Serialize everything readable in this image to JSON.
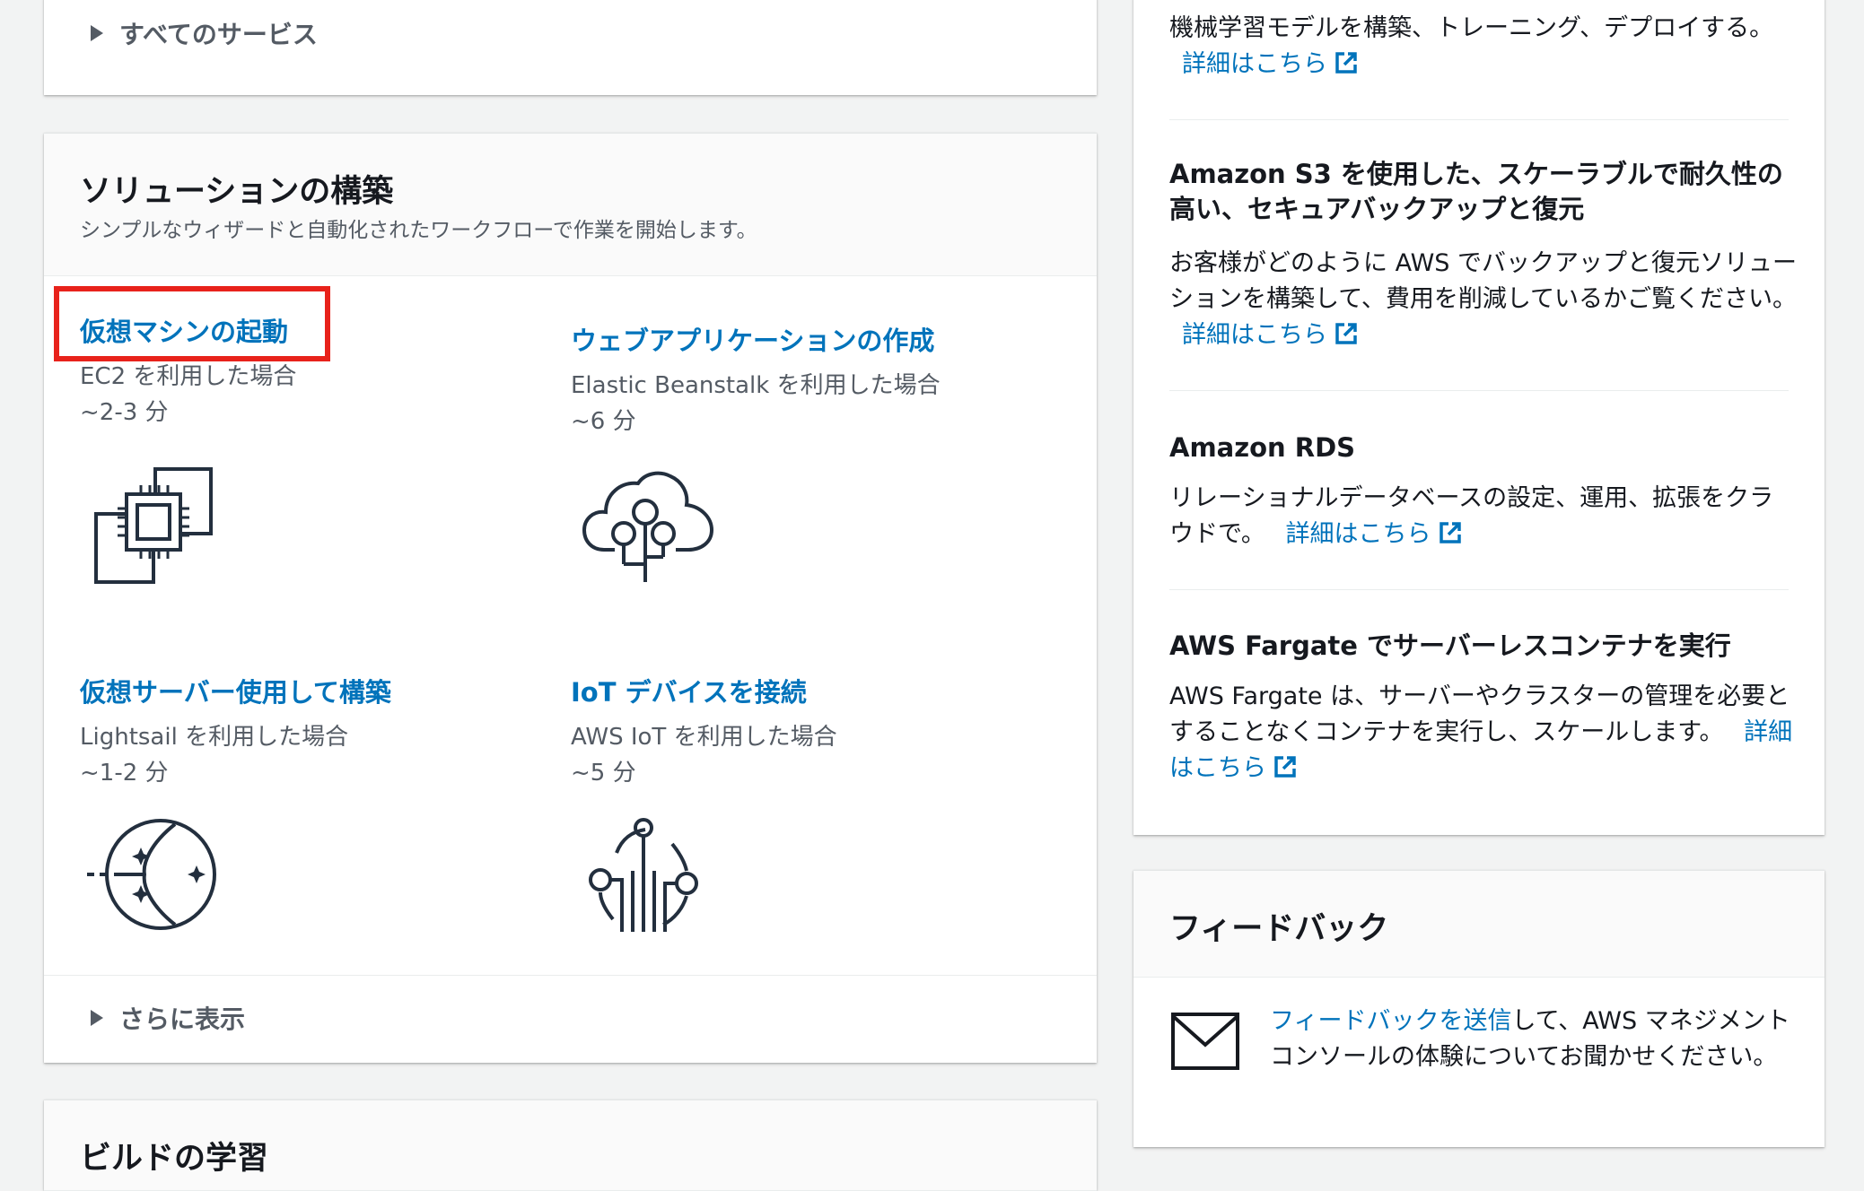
{
  "all_services": {
    "label": "すべてのサービス"
  },
  "solutions": {
    "title": "ソリューションの構築",
    "subtitle": "シンプルなウィザードと自動化されたワークフローで作業を開始します。",
    "items": [
      {
        "title": "仮想マシンの起動",
        "via": "EC2 を利用した場合",
        "time": "~2-3 分",
        "icon": "ec2-chip-icon"
      },
      {
        "title": "ウェブアプリケーションの作成",
        "via": "Elastic Beanstalk を利用した場合",
        "time": "~6 分",
        "icon": "beanstalk-cloud-icon"
      },
      {
        "title": "仮想サーバー使用して構築",
        "via": "Lightsail を利用した場合",
        "time": "~1-2 分",
        "icon": "lightsail-icon"
      },
      {
        "title": "IoT デバイスを接続",
        "via": "AWS IoT を利用した場合",
        "time": "~5 分",
        "icon": "iot-device-icon"
      }
    ],
    "show_more": "さらに表示"
  },
  "build_learning": {
    "title": "ビルドの学習"
  },
  "explore": {
    "link_text": "詳細はこちら",
    "items": [
      {
        "title": "",
        "body": "機械学習モデルを構築、トレーニング、デプロイする。"
      },
      {
        "title": "Amazon S3 を使用した、スケーラブルで耐久性の高い、セキュアバックアップと復元",
        "body": "お客様がどのように AWS でバックアップと復元ソリューションを構築して、費用を削減しているかご覧ください。"
      },
      {
        "title": "Amazon RDS",
        "body": "リレーショナルデータベースの設定、運用、拡張をクラウドで。"
      },
      {
        "title": "AWS Fargate でサーバーレスコンテナを実行",
        "body": "AWS Fargate は、サーバーやクラスターの管理を必要とすることなくコンテナを実行し、スケールします。"
      }
    ]
  },
  "feedback": {
    "title": "フィードバック",
    "link": "フィードバックを送信",
    "text": "して、AWS マネジメントコンソールの体験についてお聞かせください。"
  },
  "colors": {
    "link": "#0073bb",
    "highlight": "#e8221b",
    "text": "#16191f",
    "muted": "#545b64"
  }
}
